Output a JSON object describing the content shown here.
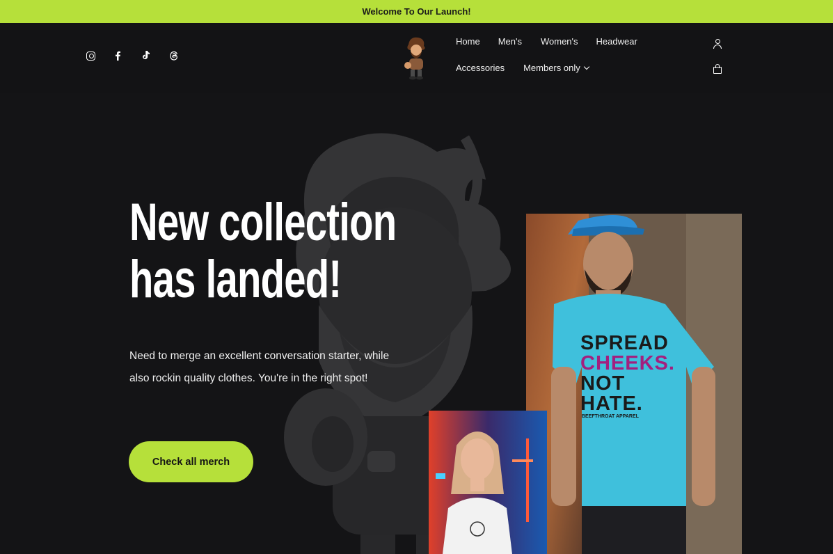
{
  "announcement": "Welcome To Our Launch!",
  "socials": [
    "instagram-icon",
    "facebook-icon",
    "tiktok-icon",
    "threads-icon"
  ],
  "nav": {
    "home": "Home",
    "mens": "Men's",
    "womens": "Women's",
    "headwear": "Headwear",
    "accessories": "Accessories",
    "members": "Members only"
  },
  "hero": {
    "headline_line1": "New collection",
    "headline_line2": "has landed!",
    "subtext": "Need to merge an excellent conversation starter, while also rockin quality clothes. You're in the right spot!",
    "cta": "Check all merch"
  },
  "shirt_print": {
    "line1": "SPREAD",
    "line2": "CHEEKS.",
    "line3": "NOT",
    "line4": "HATE.",
    "brand": "BEEFTHROAT APPAREL"
  },
  "colors": {
    "accent": "#b6e03a",
    "background": "#141416",
    "shirt": "#3fc0dc",
    "print_magenta": "#a2207f"
  }
}
